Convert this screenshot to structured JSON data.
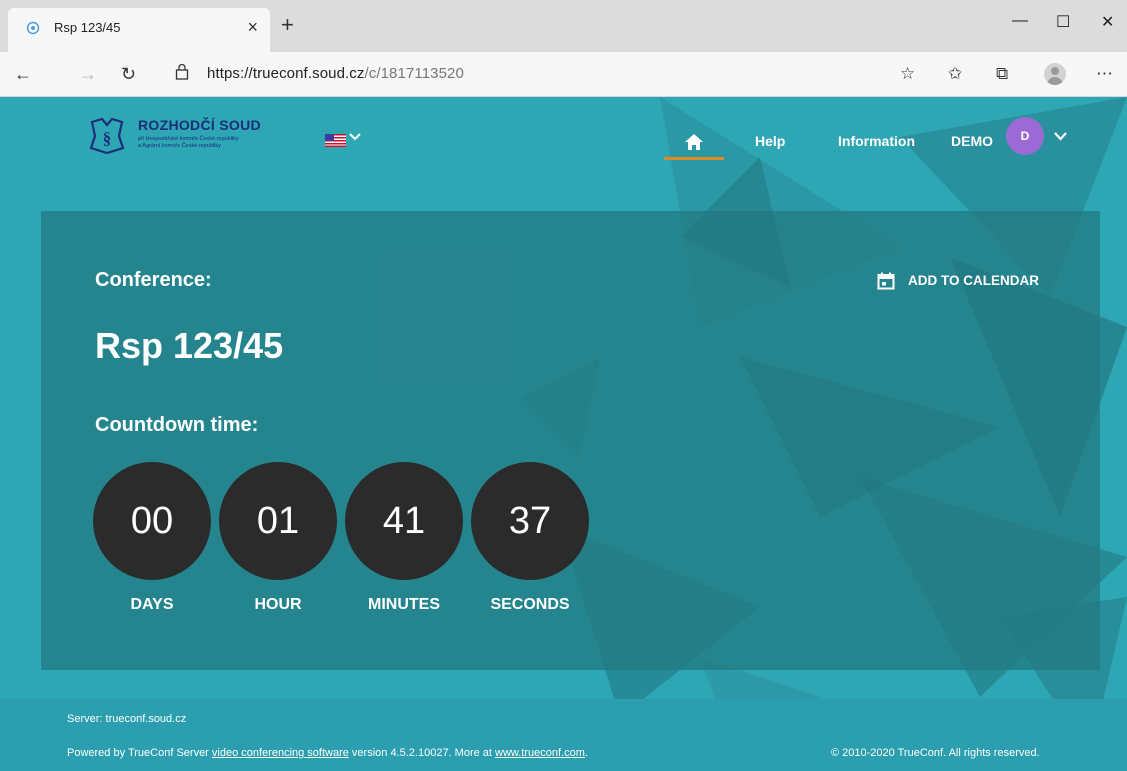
{
  "browser": {
    "tab_title": "Rsp 123/45",
    "url_host": "https://trueconf.soud.cz",
    "url_path": "/c/1817113520"
  },
  "site": {
    "logo": {
      "title": "ROZHODČÍ SOUD",
      "subtitle_1": "při Hospodářské komoře České republiky",
      "subtitle_2": "a Agrární komoře České republiky"
    },
    "nav": {
      "help": "Help",
      "information": "Information",
      "user": "DEMO",
      "avatar_letter": "D"
    },
    "conference": {
      "label": "Conference:",
      "name": "Rsp 123/45",
      "add_to_calendar": "ADD TO CALENDAR",
      "countdown_label": "Countdown time:",
      "countdown": [
        {
          "value": "00",
          "unit": "DAYS"
        },
        {
          "value": "01",
          "unit": "HOUR"
        },
        {
          "value": "41",
          "unit": "MINUTES"
        },
        {
          "value": "37",
          "unit": "SECONDS"
        }
      ]
    },
    "footer": {
      "server": "Server: trueconf.soud.cz",
      "powered_prefix": "Powered by TrueConf Server ",
      "powered_link": "video conferencing software",
      "powered_mid": " version 4.5.2.10027. More at ",
      "site_link": "www.trueconf.com",
      "powered_suffix": ".",
      "copyright": "© 2010-2020 TrueConf. All rights reserved."
    }
  },
  "colors": {
    "page_bg": "#2ea7b5",
    "card_bg": "#237880",
    "accent": "#e08a1f",
    "avatar": "#9c6ad4",
    "logo_text": "#1c2d7a"
  }
}
